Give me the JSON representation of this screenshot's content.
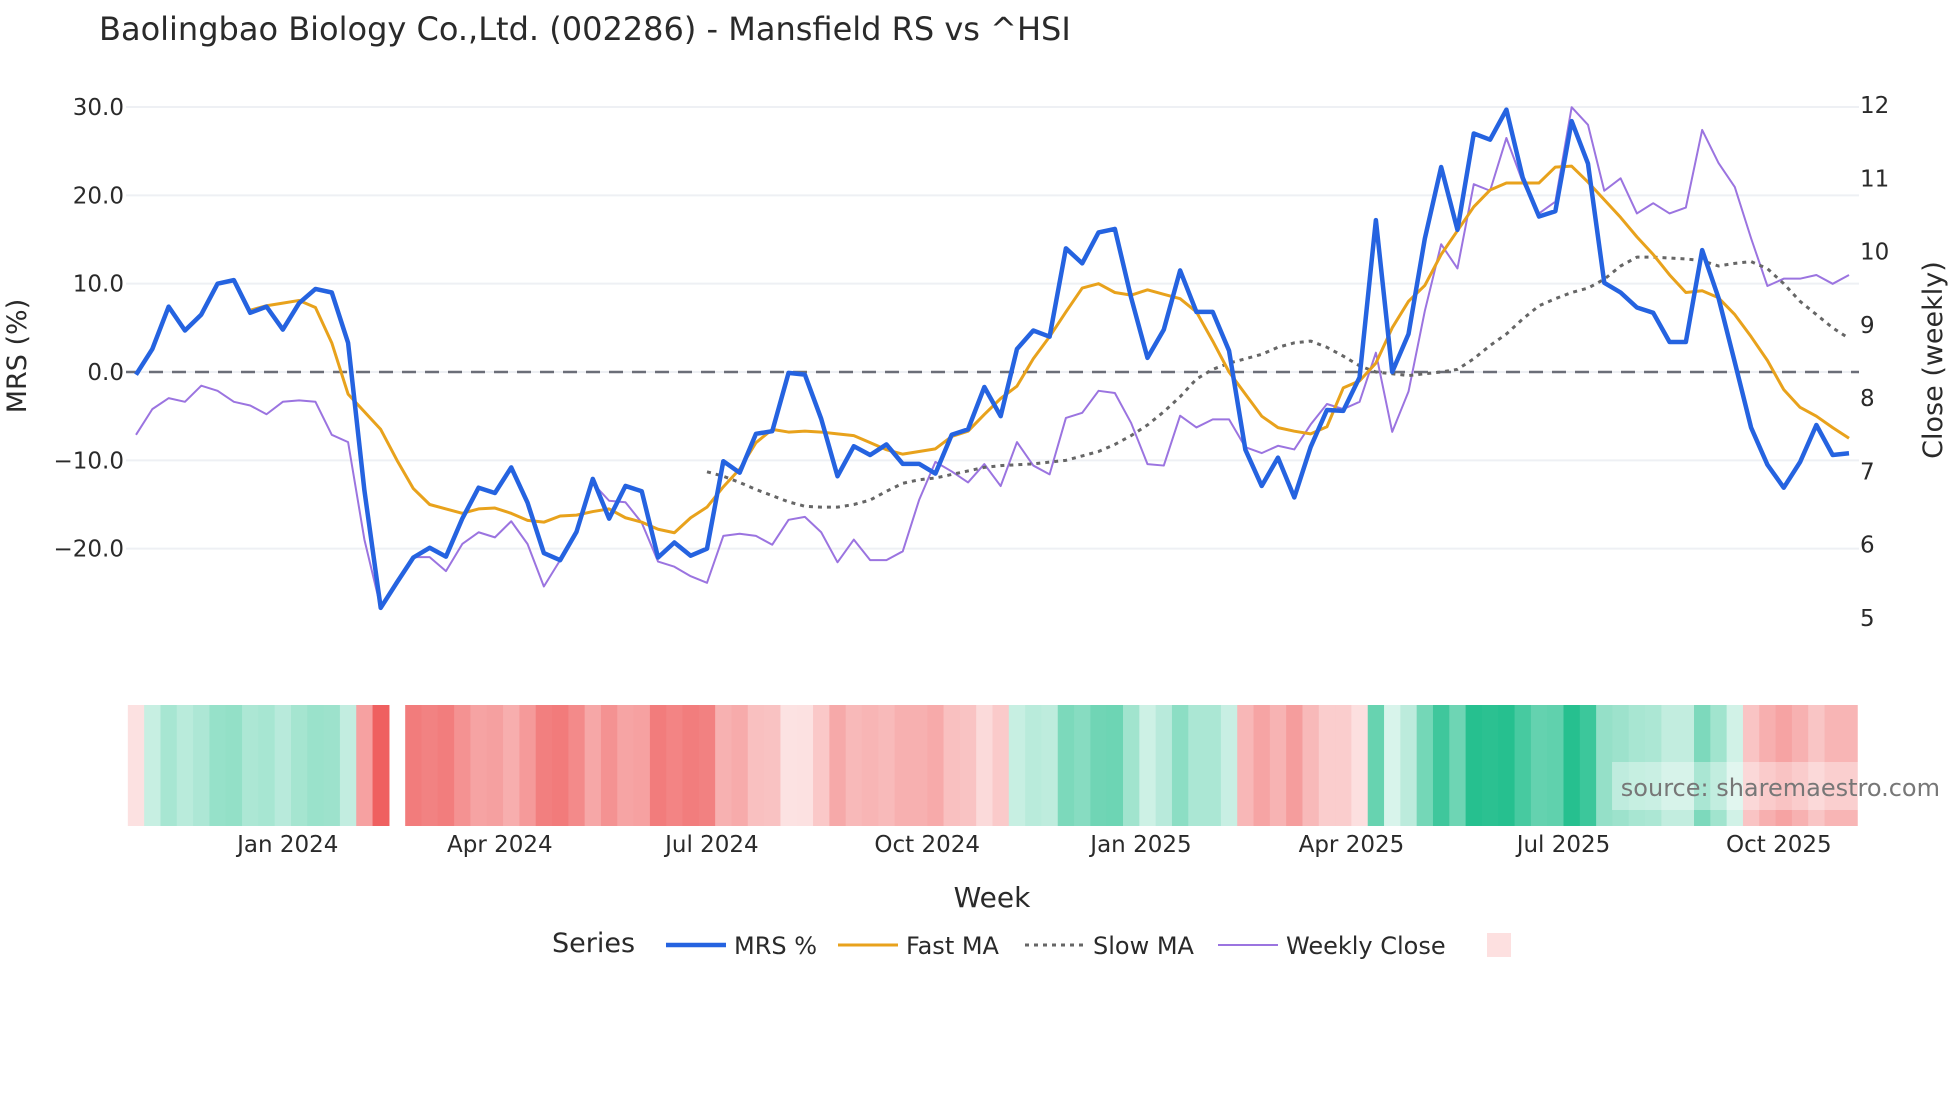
{
  "chart_data": {
    "type": "line",
    "title": "Baolingbao Biology Co.,Ltd. (002286) - Mansfield RS vs ^HSI",
    "xlabel": "Week",
    "ylabel_left": "MRS (%)",
    "ylabel_right": "Close (weekly)",
    "ylim_left": [
      -30,
      30
    ],
    "ylim_right": [
      5,
      12
    ],
    "yticks_left": [
      "30.0",
      "20.0",
      "10.0",
      "0.0",
      "−10.0",
      "−20.0"
    ],
    "yticks_left_values": [
      30,
      20,
      10,
      0,
      -10,
      -20
    ],
    "yticks_right": [
      "12",
      "11",
      "10",
      "9",
      "8",
      "7",
      "6",
      "5"
    ],
    "yticks_right_values": [
      12,
      11,
      10,
      9,
      8,
      7,
      6,
      5
    ],
    "xticks": [
      {
        "label": "Jan 2024",
        "week_index": 9.3
      },
      {
        "label": "Apr 2024",
        "week_index": 22.3
      },
      {
        "label": "Jul 2024",
        "week_index": 35.3
      },
      {
        "label": "Oct 2024",
        "week_index": 48.5
      },
      {
        "label": "Jan 2025",
        "week_index": 61.6
      },
      {
        "label": "Apr 2025",
        "week_index": 74.5
      },
      {
        "label": "Jul 2025",
        "week_index": 87.5
      },
      {
        "label": "Oct 2025",
        "week_index": 100.7
      }
    ],
    "zero_line": 0,
    "legend_title": "Series",
    "legend_placement": "bottom-center",
    "source_note": "source: sharemaestro.com",
    "series": [
      {
        "name": "MRS %",
        "axis": "left",
        "color": "#2563e0",
        "style": "solid-thick",
        "values": [
          -0.3,
          2.6,
          7.4,
          4.7,
          6.5,
          10,
          10.4,
          6.7,
          7.4,
          4.8,
          7.8,
          9.4,
          9,
          3.3,
          -13.4,
          -26.7,
          -23.8,
          -21,
          -19.9,
          -20.9,
          -16.6,
          -13.1,
          -13.7,
          -10.8,
          -14.8,
          -20.5,
          -21.3,
          -18.1,
          -12.1,
          -16.6,
          -12.9,
          -13.5,
          -21,
          -19.3,
          -20.8,
          -20,
          -10.1,
          -11.4,
          -7,
          -6.7,
          -0.1,
          -0.3,
          -5.3,
          -11.8,
          -8.4,
          -9.4,
          -8.2,
          -10.4,
          -10.4,
          -11.5,
          -7.1,
          -6.5,
          -1.7,
          -5,
          2.6,
          4.7,
          4,
          14,
          12.3,
          15.8,
          16.2,
          8.4,
          1.6,
          4.8,
          11.5,
          6.8,
          6.8,
          2.4,
          -8.8,
          -12.9,
          -9.7,
          -14.2,
          -8.5,
          -4.3,
          -4.4,
          -0.6,
          17.2,
          0,
          4.3,
          15.1,
          23.2,
          16.1,
          27,
          26.3,
          29.7,
          22,
          17.6,
          18.2,
          28.4,
          23.6,
          10.1,
          9,
          7.3,
          6.7,
          3.4,
          3.4,
          13.8,
          8.4,
          1.1,
          -6.3,
          -10.5,
          -13.1,
          -10.2,
          -6,
          -9.4,
          -9.2
        ]
      },
      {
        "name": "Fast MA",
        "axis": "left",
        "color": "#e8a21c",
        "style": "solid",
        "values": [
          7,
          7.5,
          7.8,
          8.1,
          7.3,
          3.3,
          -2.5,
          -4.5,
          -6.5,
          -10,
          -13.2,
          -15,
          -15.5,
          -16,
          -15.5,
          -15.4,
          -16,
          -16.8,
          -17,
          -16.3,
          -16.2,
          -15.8,
          -15.5,
          -16.5,
          -17,
          -17.8,
          -18.2,
          -16.5,
          -15.3,
          -13,
          -11,
          -8,
          -6.5,
          -6.8,
          -6.7,
          -6.8,
          -7,
          -7.2,
          -8,
          -8.8,
          -9.3,
          -9,
          -8.7,
          -7.3,
          -6.7,
          -4.8,
          -3,
          -1.6,
          1.5,
          4,
          6.8,
          9.5,
          10,
          9,
          8.7,
          9.3,
          8.8,
          8.3,
          6.8,
          3.5,
          0,
          -2.5,
          -5,
          -6.3,
          -6.7,
          -7,
          -6.2,
          -1.8,
          -1,
          1,
          5,
          8,
          9.8,
          13.3,
          16,
          18.7,
          20.6,
          21.4,
          21.4,
          21.4,
          23.2,
          23.3,
          21.5,
          19.5,
          17.5,
          15.3,
          13.3,
          11,
          9,
          9.2,
          8.4,
          6.5,
          4,
          1.3,
          -2,
          -4,
          -5,
          -6.3,
          -7.5
        ]
      },
      {
        "name": "Slow MA",
        "axis": "left",
        "color": "#666666",
        "style": "dotted",
        "values": [
          -11.3,
          -11.8,
          -12.5,
          -13.3,
          -14,
          -14.7,
          -15.2,
          -15.3,
          -15.3,
          -15,
          -14.5,
          -13.5,
          -12.6,
          -12.2,
          -12,
          -11.6,
          -11.2,
          -10.8,
          -10.6,
          -10.5,
          -10.4,
          -10.2,
          -10,
          -9.5,
          -9,
          -8.2,
          -7.2,
          -6,
          -4.5,
          -2.8,
          -0.8,
          0.3,
          1,
          1.5,
          2,
          2.8,
          3.3,
          3.5,
          2.8,
          1.8,
          0.7,
          0,
          -0.2,
          -0.4,
          -0.2,
          0,
          0.3,
          1.5,
          3,
          4.3,
          6,
          7.5,
          8.3,
          9,
          9.5,
          10.5,
          12,
          13,
          13,
          12.9,
          12.8,
          12.6,
          12,
          12.3,
          12.5,
          11.7,
          10,
          8,
          6.5,
          5,
          3.8
        ]
      },
      {
        "name": "Weekly Close",
        "axis": "right",
        "color": "#9b74e0",
        "style": "solid-thin",
        "values": [
          7.5,
          7.85,
          8,
          7.95,
          8.17,
          8.1,
          7.95,
          7.9,
          7.78,
          7.95,
          7.97,
          7.95,
          7.5,
          7.4,
          6.07,
          5.14,
          5.5,
          5.83,
          5.83,
          5.64,
          6.01,
          6.17,
          6.1,
          6.32,
          6.01,
          5.43,
          5.79,
          6.2,
          6.84,
          6.6,
          6.58,
          6.3,
          5.77,
          5.7,
          5.57,
          5.48,
          6.12,
          6.15,
          6.12,
          6,
          6.34,
          6.38,
          6.17,
          5.76,
          6.07,
          5.79,
          5.79,
          5.91,
          6.61,
          7.13,
          7,
          6.85,
          7.1,
          6.8,
          7.4,
          7.08,
          6.96,
          7.73,
          7.8,
          8.1,
          8.07,
          7.66,
          7.1,
          7.08,
          7.76,
          7.6,
          7.71,
          7.71,
          7.33,
          7.25,
          7.35,
          7.3,
          7.64,
          7.92,
          7.85,
          7.95,
          8.62,
          7.54,
          8.09,
          9.19,
          10.1,
          9.77,
          10.92,
          10.83,
          11.55,
          10.95,
          10.52,
          10.68,
          11.97,
          11.73,
          10.83,
          11,
          10.52,
          10.66,
          10.52,
          10.6,
          11.66,
          11.21,
          10.88,
          10.18,
          9.53,
          9.63,
          9.63,
          9.68,
          9.56,
          9.68
        ]
      }
    ],
    "heatmap": {
      "based_on": "MRS %",
      "positive_color": "#26c08f",
      "negative_color": "#ef5f5f",
      "missing_week_indexes": [
        16
      ]
    }
  }
}
